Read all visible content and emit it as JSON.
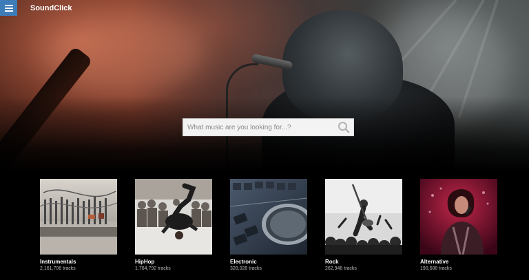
{
  "app": {
    "name": "SoundClick"
  },
  "header": {
    "menu_icon": "hamburger-menu-icon"
  },
  "search": {
    "placeholder": "What music are you looking for...?",
    "value": "",
    "icon": "search-icon"
  },
  "categories": [
    {
      "name": "Instrumentals",
      "count": "2,161,706 tracks"
    },
    {
      "name": "HipHop",
      "count": "1,764,792 tracks"
    },
    {
      "name": "Electronic",
      "count": "328,028 tracks"
    },
    {
      "name": "Rock",
      "count": "262,948 tracks"
    },
    {
      "name": "Alternative",
      "count": "190,588 tracks"
    }
  ],
  "colors": {
    "accent": "#3d7cb8",
    "background": "#000000",
    "text": "#ffffff",
    "subtext": "#bdbdbd",
    "search_bg": "#f3f3f3"
  }
}
